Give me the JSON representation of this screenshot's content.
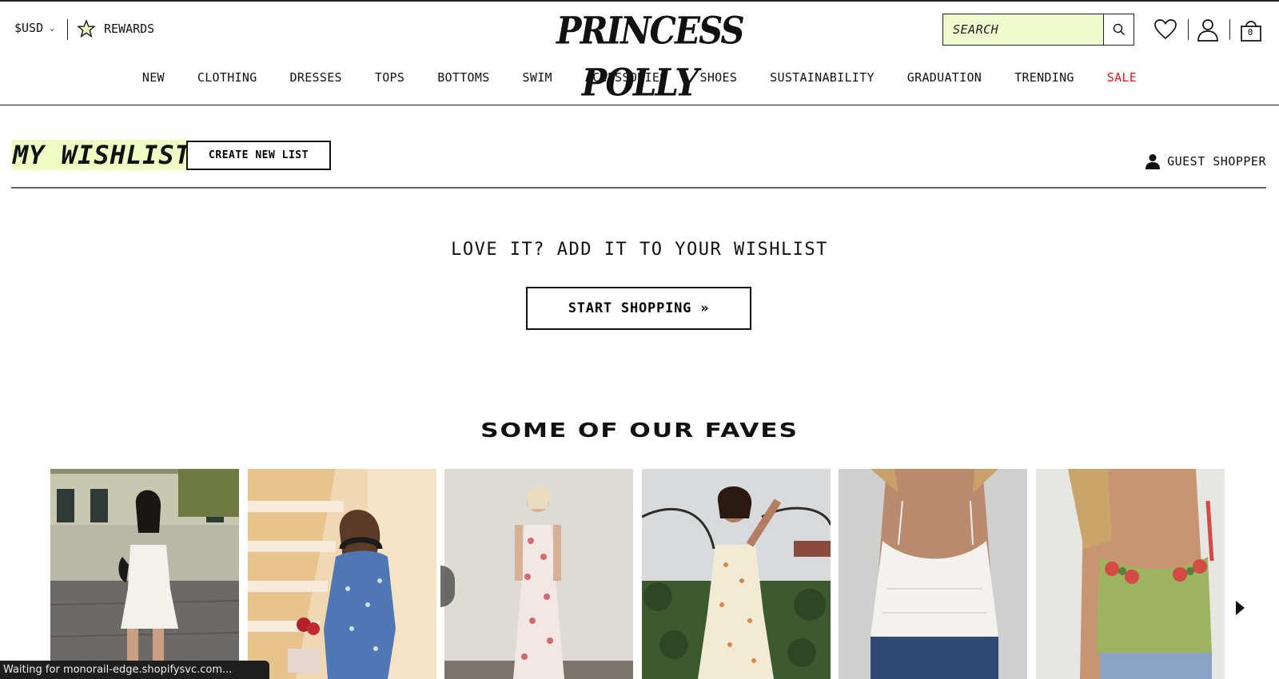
{
  "header": {
    "currency": "$USD",
    "rewards_label": "REWARDS",
    "logo_text": "PRINCESS POLLY",
    "search_placeholder": "SEARCH",
    "cart_count": "0"
  },
  "nav": {
    "items": [
      "NEW",
      "CLOTHING",
      "DRESSES",
      "TOPS",
      "BOTTOMS",
      "SWIM",
      "ACCESSORIES",
      "SHOES",
      "SUSTAINABILITY",
      "GRADUATION",
      "TRENDING",
      "SALE"
    ],
    "sale_color": "#e01a1a"
  },
  "wishlist": {
    "title": "MY WISHLIST",
    "create_button": "CREATE NEW LIST",
    "guest_label": "GUEST SHOPPER",
    "empty_message": "LOVE IT? ADD IT TO YOUR WISHLIST",
    "start_button": "START SHOPPING »"
  },
  "faves": {
    "heading": "SOME OF OUR FAVES",
    "products": [
      {
        "image": "white-mini-dress-street"
      },
      {
        "image": "blue-floral-dress-steps"
      },
      {
        "image": "floral-maxi-slip-dress"
      },
      {
        "image": "cream-floral-midi-dress"
      },
      {
        "image": "white-babydoll-cami"
      },
      {
        "image": "green-floral-corset-top"
      }
    ]
  },
  "status_bar": "Waiting for monorail-edge.shopifysvc.com...",
  "colors": {
    "highlight": "#eefcc4",
    "search_bg": "#f1f9cf",
    "text": "#111111"
  }
}
